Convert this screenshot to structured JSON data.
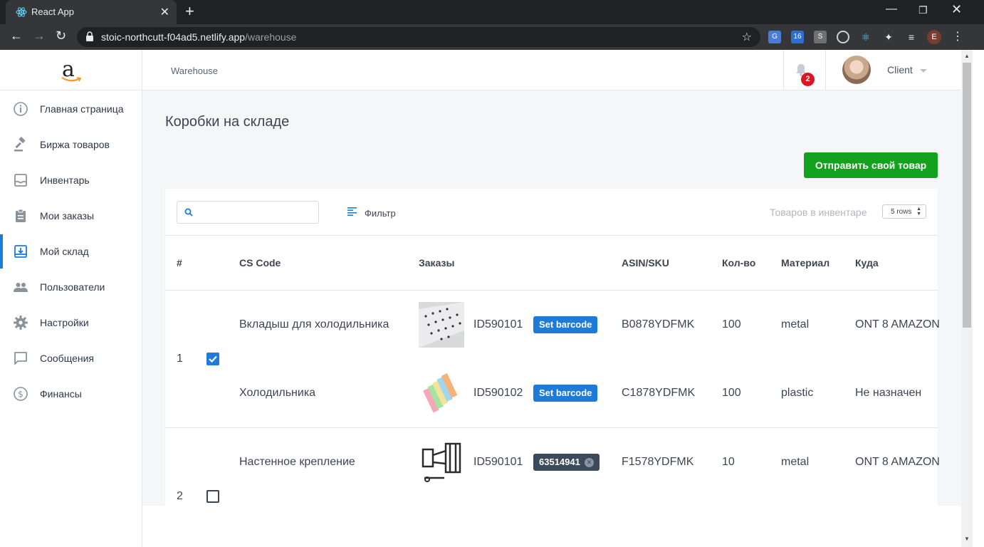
{
  "browser": {
    "tab_title": "React App",
    "url_host": "stoic-northcutt-f04ad5.netlify.app",
    "url_path": "/warehouse",
    "profile_initial": "E"
  },
  "app": {
    "breadcrumb": "Warehouse",
    "notification_count": "2",
    "user_name": "Client",
    "sidebar": [
      {
        "label": "Главная страница",
        "icon": "info-icon"
      },
      {
        "label": "Биржа товаров",
        "icon": "gavel-icon"
      },
      {
        "label": "Инвентарь",
        "icon": "inbox-icon"
      },
      {
        "label": "Мои заказы",
        "icon": "clipboard-icon"
      },
      {
        "label": "Мой склад",
        "icon": "archive-icon",
        "active": true
      },
      {
        "label": "Пользователи",
        "icon": "users-icon"
      },
      {
        "label": "Настройки",
        "icon": "gear-icon"
      },
      {
        "label": "Сообщения",
        "icon": "chat-icon"
      },
      {
        "label": "Финансы",
        "icon": "dollar-icon"
      }
    ],
    "page_title": "Коробки на складе",
    "send_button": "Отправить свой товар",
    "filter_label": "Фильтр",
    "inventory_label": "Товаров в инвентаре",
    "rows_select": "5 rows",
    "columns": [
      "#",
      "CS Code",
      "Заказы",
      "ASIN/SKU",
      "Кол-во",
      "Материал",
      "Куда"
    ],
    "rows": [
      {
        "num": "1",
        "checked": true,
        "items": [
          {
            "name": "Вкладыш для холодильника",
            "order_id": "ID590101",
            "barcode": "Set barcode",
            "asin": "B0878YDFMK",
            "qty": "100",
            "material": "metal",
            "dest": "ONT 8 AMAZON"
          },
          {
            "name": "Холодильника",
            "order_id": "ID590102",
            "barcode": "Set barcode",
            "asin": "C1878YDFMK",
            "qty": "100",
            "material": "plastic",
            "dest": "Не назначен"
          }
        ]
      },
      {
        "num": "2",
        "checked": false,
        "items": [
          {
            "name": "Настенное крепление",
            "order_id": "ID590101",
            "barcode": "63514941",
            "asin": "F1578YDFMK",
            "qty": "10",
            "material": "metal",
            "dest": "ONT 8 AMAZON"
          }
        ]
      }
    ]
  },
  "colors": {
    "accent": "#1e7bd8",
    "primary_button": "#12a21d",
    "badge": "#e0141e"
  }
}
